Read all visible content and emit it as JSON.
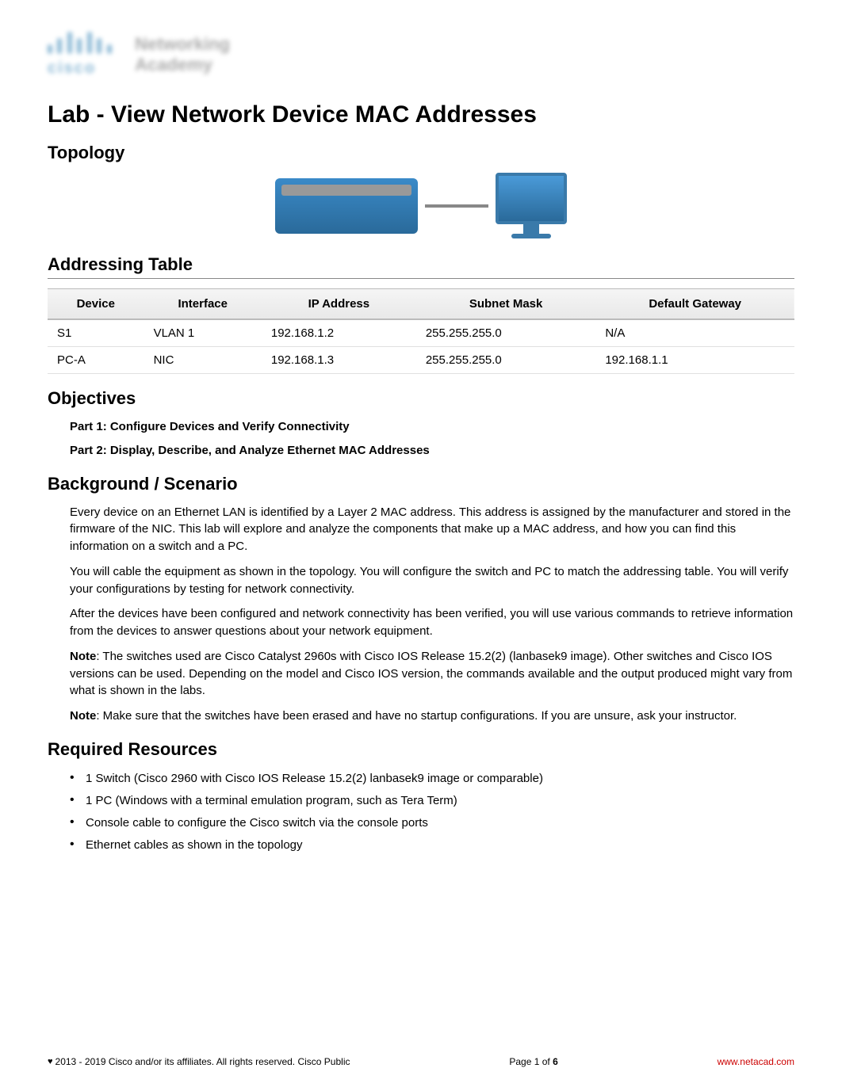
{
  "logo": {
    "brand": "cisco",
    "text_line1": "Networking",
    "text_line2": "Academy"
  },
  "title": "Lab - View Network Device MAC Addresses",
  "sections": {
    "topology": {
      "heading": "Topology"
    },
    "addressing": {
      "heading": "Addressing Table",
      "columns": [
        "Device",
        "Interface",
        "IP Address",
        "Subnet Mask",
        "Default Gateway"
      ],
      "rows": [
        {
          "device": "S1",
          "interface": "VLAN 1",
          "ip": "192.168.1.2",
          "mask": "255.255.255.0",
          "gateway": "N/A"
        },
        {
          "device": "PC-A",
          "interface": "NIC",
          "ip": "192.168.1.3",
          "mask": "255.255.255.0",
          "gateway": "192.168.1.1"
        }
      ]
    },
    "objectives": {
      "heading": "Objectives",
      "parts": [
        "Part 1: Configure Devices and Verify Connectivity",
        "Part 2: Display, Describe, and Analyze Ethernet MAC Addresses"
      ]
    },
    "background": {
      "heading": "Background / Scenario",
      "paragraphs": [
        "Every device on an Ethernet LAN is identified by a Layer 2 MAC address. This address is assigned by the manufacturer and stored in the firmware of the NIC. This lab will explore and analyze the components that make up a MAC address, and how you can find this information on a switch and a PC.",
        "You will cable the equipment as shown in the topology. You will configure the switch and PC to match the addressing table. You will verify your configurations by testing for network connectivity.",
        "After the devices have been configured and network connectivity has been verified, you will use various commands to retrieve information from the devices to answer questions about your network equipment."
      ],
      "note1_label": "Note",
      "note1_text": ": The switches used are Cisco Catalyst 2960s with Cisco IOS Release 15.2(2) (lanbasek9 image). Other switches and Cisco IOS versions can be used. Depending on the model and Cisco IOS version, the commands available and the output produced might vary from what is shown in the labs.",
      "note2_label": "Note",
      "note2_text": ": Make sure that the switches have been erased and have no startup configurations. If you are unsure, ask your instructor."
    },
    "resources": {
      "heading": "Required Resources",
      "items": [
        "1 Switch (Cisco 2960 with Cisco IOS Release 15.2(2) lanbasek9 image or comparable)",
        "1 PC (Windows with a terminal emulation program, such as Tera Term)",
        "Console cable to configure the Cisco switch via the console ports",
        "Ethernet cables as shown in the topology"
      ]
    }
  },
  "footer": {
    "copyright": "2013 - 2019 Cisco and/or its affiliates. All rights reserved. Cisco Public",
    "page_label": "Page 1 of ",
    "page_total": "6",
    "link": "www.netacad.com"
  }
}
